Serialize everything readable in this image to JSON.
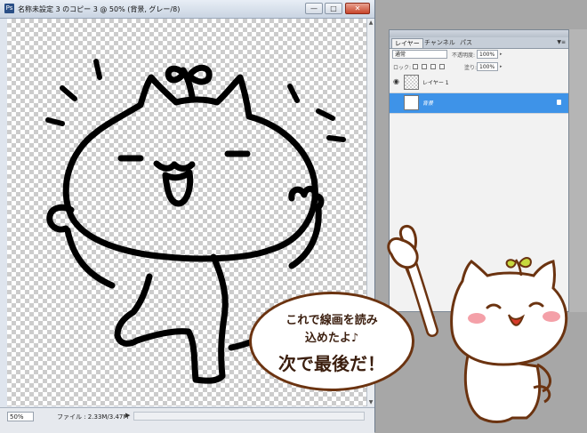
{
  "document_window": {
    "title": "名称未設定 3 のコピー 3 @ 50% (背景, グレー/8)",
    "controls": {
      "minimize": "—",
      "maximize": "□",
      "close": "✕"
    }
  },
  "status_bar": {
    "zoom": "50%",
    "file_info": "ファイル : 2.33M/3.47M",
    "arrow": "▶"
  },
  "layers_panel": {
    "tabs": [
      "レイヤー",
      "チャンネル",
      "パス"
    ],
    "active_tab": "レイヤー",
    "menu_icon": "▼≡",
    "blend_mode": "通常",
    "opacity_label": "不透明度:",
    "opacity_value": "100%",
    "lock_label": "ロック:",
    "fill_label": "塗り:",
    "fill_value": "100%",
    "layers": [
      {
        "name": "レイヤー 1",
        "visible": true,
        "selected": false,
        "thumb": "transparent"
      },
      {
        "name": "背景",
        "visible": false,
        "selected": true,
        "thumb": "white",
        "locked": true
      }
    ]
  },
  "speech_bubble": {
    "line1": "これで線画を読み",
    "line2": "込めたよ♪",
    "line3": "次で最後だ！"
  },
  "colors": {
    "selection_blue": "#3e93e8",
    "bubble_border": "#6b3310",
    "background_gray": "#a7a7a7"
  }
}
